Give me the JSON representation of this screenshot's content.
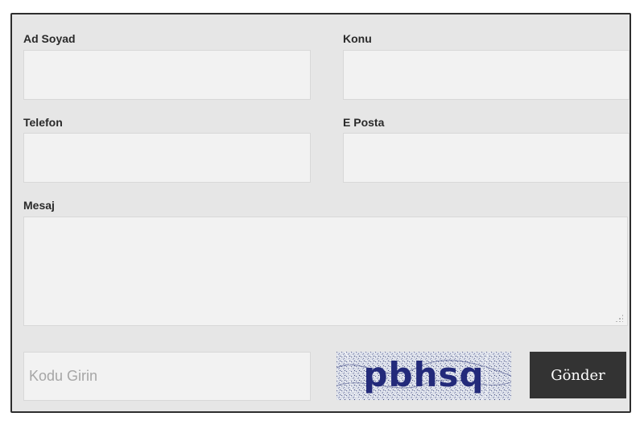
{
  "form": {
    "fields": {
      "name": {
        "label": "Ad Soyad",
        "value": ""
      },
      "subject": {
        "label": "Konu",
        "value": ""
      },
      "phone": {
        "label": "Telefon",
        "value": ""
      },
      "email": {
        "label": "E Posta",
        "value": ""
      },
      "message": {
        "label": "Mesaj",
        "value": ""
      }
    },
    "code_input": {
      "placeholder": "Kodu Girin",
      "value": ""
    },
    "captcha": {
      "text": "pbhsq"
    },
    "submit_label": "Gönder"
  }
}
